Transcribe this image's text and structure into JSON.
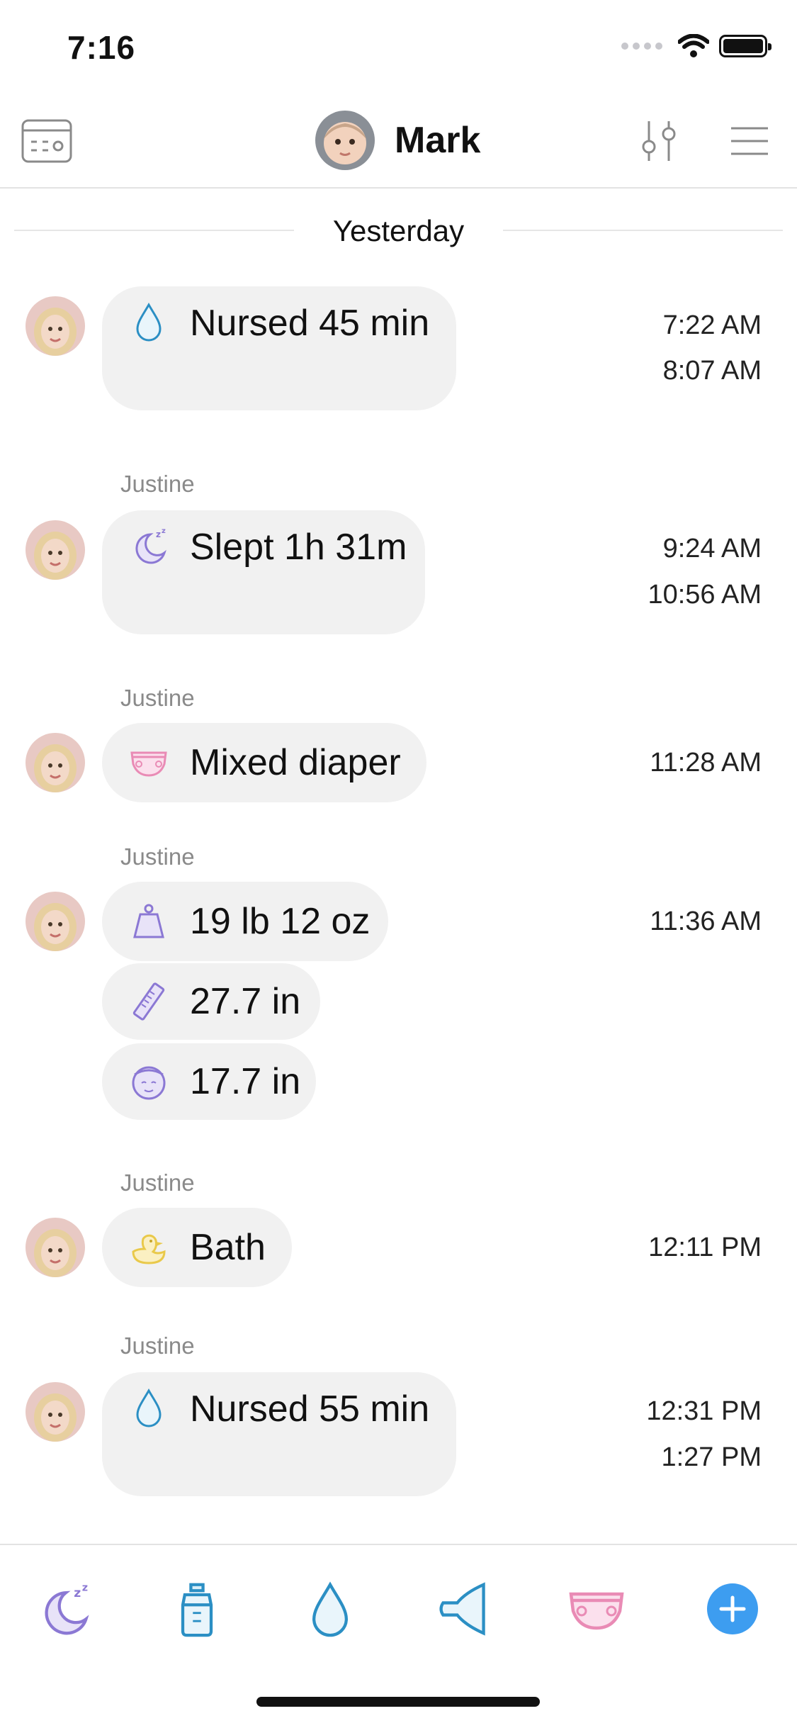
{
  "status": {
    "time": "7:16"
  },
  "nav": {
    "child_name": "Mark"
  },
  "day_header": "Yesterday",
  "entries": [
    {
      "author": "",
      "label": "Nursed 45 min",
      "icon": "drop-icon",
      "start": "7:22 AM",
      "end": "8:07 AM"
    },
    {
      "author": "Justine",
      "label": "Slept 1h 31m",
      "icon": "moon-sleep-icon",
      "start": "9:24 AM",
      "end": "10:56 AM"
    },
    {
      "author": "Justine",
      "label": "Mixed diaper",
      "icon": "diaper-icon",
      "start": "11:28 AM"
    },
    {
      "author": "Justine",
      "items": [
        {
          "label": "19 lb 12 oz",
          "icon": "weight-icon"
        },
        {
          "label": "27.7 in",
          "icon": "ruler-icon"
        },
        {
          "label": "17.7 in",
          "icon": "head-icon"
        }
      ],
      "start": "11:36 AM"
    },
    {
      "author": "Justine",
      "label": "Bath",
      "icon": "duck-icon",
      "start": "12:11 PM"
    },
    {
      "author": "Justine",
      "label": "Nursed 55 min",
      "icon": "drop-icon",
      "start": "12:31 PM",
      "end": "1:27 PM"
    }
  ],
  "colors": {
    "purple": "#8b78d4",
    "blue": "#2b8fc4",
    "pink": "#e98bb5",
    "yellow": "#e9c94a",
    "accent": "#3d9df0"
  },
  "tabbar": [
    "moon-sleep-icon",
    "bottle-icon",
    "drop-icon",
    "pump-icon",
    "diaper-icon",
    "add-icon"
  ]
}
